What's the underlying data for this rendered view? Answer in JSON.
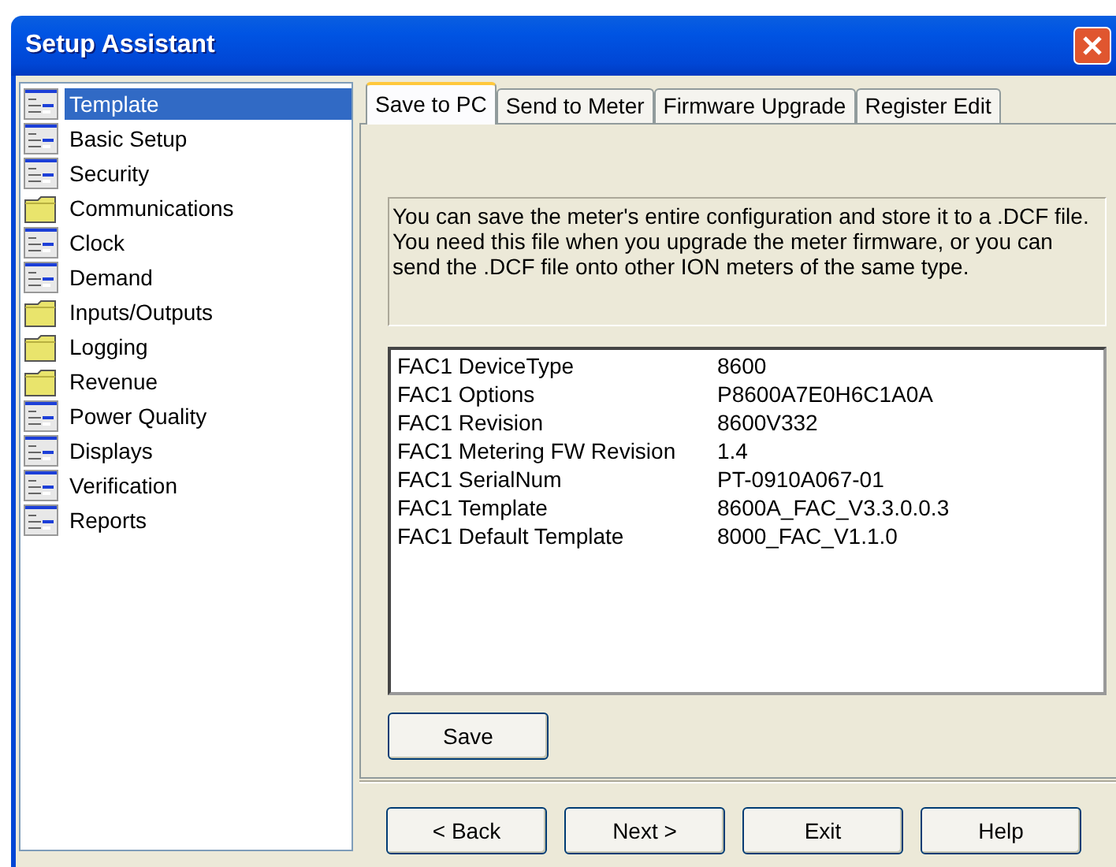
{
  "window": {
    "title": "Setup Assistant"
  },
  "sidebar": {
    "items": [
      {
        "label": "Template",
        "kind": "page",
        "selected": true
      },
      {
        "label": "Basic Setup",
        "kind": "page",
        "selected": false
      },
      {
        "label": "Security",
        "kind": "page",
        "selected": false
      },
      {
        "label": "Communications",
        "kind": "folder",
        "selected": false
      },
      {
        "label": "Clock",
        "kind": "page",
        "selected": false
      },
      {
        "label": "Demand",
        "kind": "page",
        "selected": false
      },
      {
        "label": "Inputs/Outputs",
        "kind": "folder",
        "selected": false
      },
      {
        "label": "Logging",
        "kind": "folder",
        "selected": false
      },
      {
        "label": "Revenue",
        "kind": "folder",
        "selected": false
      },
      {
        "label": "Power Quality",
        "kind": "page",
        "selected": false
      },
      {
        "label": "Displays",
        "kind": "page",
        "selected": false
      },
      {
        "label": "Verification",
        "kind": "page",
        "selected": false
      },
      {
        "label": "Reports",
        "kind": "page",
        "selected": false
      }
    ]
  },
  "tabs": [
    {
      "label": "Save to PC",
      "selected": true
    },
    {
      "label": "Send to Meter",
      "selected": false
    },
    {
      "label": "Firmware Upgrade",
      "selected": false
    },
    {
      "label": "Register Edit",
      "selected": false
    }
  ],
  "description": "You can save the meter's entire configuration and store it to a .DCF file. You need this file when you upgrade the meter firmware, or you can send the .DCF file onto other ION meters of the same type.",
  "properties": [
    {
      "name": "FAC1 DeviceType",
      "value": "8600"
    },
    {
      "name": "FAC1 Options",
      "value": "P8600A7E0H6C1A0A"
    },
    {
      "name": "FAC1 Revision",
      "value": "8600V332"
    },
    {
      "name": "FAC1 Metering FW Revision",
      "value": "1.4"
    },
    {
      "name": "FAC1 SerialNum",
      "value": "PT-0910A067-01"
    },
    {
      "name": "FAC1 Template",
      "value": "8600A_FAC_V3.3.0.0.3"
    },
    {
      "name": "FAC1 Default Template",
      "value": "8000_FAC_V1.1.0"
    }
  ],
  "save_button": "Save",
  "buttons": [
    "< Back",
    "Next >",
    "Exit",
    "Help"
  ]
}
